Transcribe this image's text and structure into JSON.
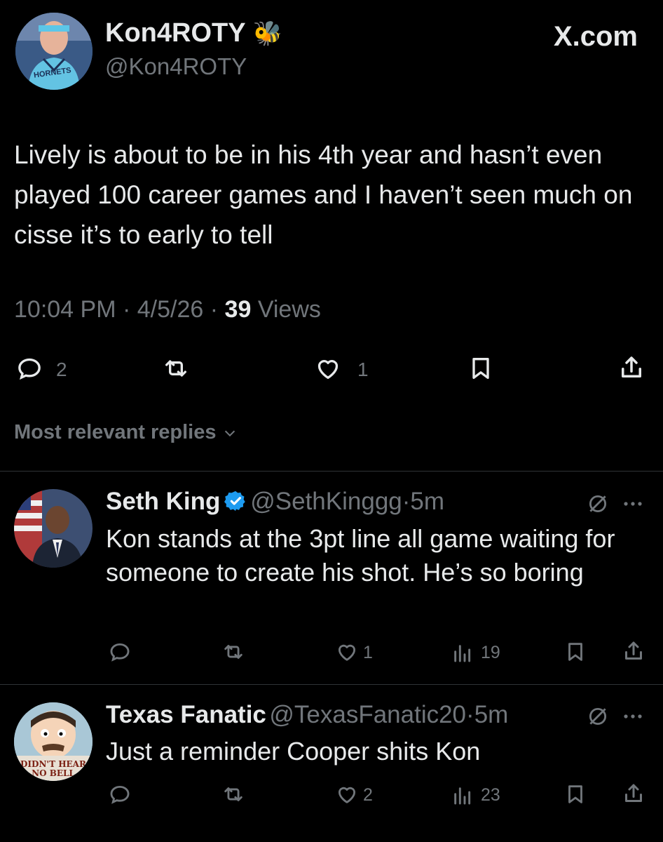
{
  "tweet": {
    "author": {
      "name": "Kon4ROTY",
      "emoji": "🐝",
      "handle": "@Kon4ROTY",
      "jersey_text": "HORNETS"
    },
    "brand": "X.com",
    "text": "Lively is about to be in his 4th year and hasn’t even played 100 career games and I haven’t seen much on cisse it’s to early to tell",
    "time": "10:04 PM",
    "date": "4/5/26",
    "views_count": "39",
    "views_label": "Views",
    "reply_count": "2",
    "like_count": "1"
  },
  "sort_label": "Most relevant replies",
  "replies": [
    {
      "name": "Seth King",
      "verified": true,
      "handle": "@SethKinggg",
      "time": "5m",
      "text": "Kon stands at the 3pt line all game waiting for someone to create his shot. He’s so boring",
      "reply_count": "",
      "like_count": "1",
      "views": "19"
    },
    {
      "name": "Texas Fanatic",
      "verified": false,
      "handle": "@TexasFanatic20",
      "time": "5m",
      "text": "Just a reminder Cooper shits Kon",
      "reply_count": "",
      "like_count": "2",
      "views": "23",
      "avatar_caption": "DIDN'T HEAR NO BELL"
    }
  ],
  "colors": {
    "background": "#000000",
    "text": "#e7e9ea",
    "secondary": "#71767b",
    "verified": "#1d9bf0",
    "divider": "#2f3336"
  },
  "icons": [
    "reply-icon",
    "retweet-icon",
    "like-icon",
    "bookmark-icon",
    "share-icon",
    "views-icon",
    "grok-icon",
    "more-icon",
    "verified-badge-icon",
    "chevron-down-icon"
  ]
}
